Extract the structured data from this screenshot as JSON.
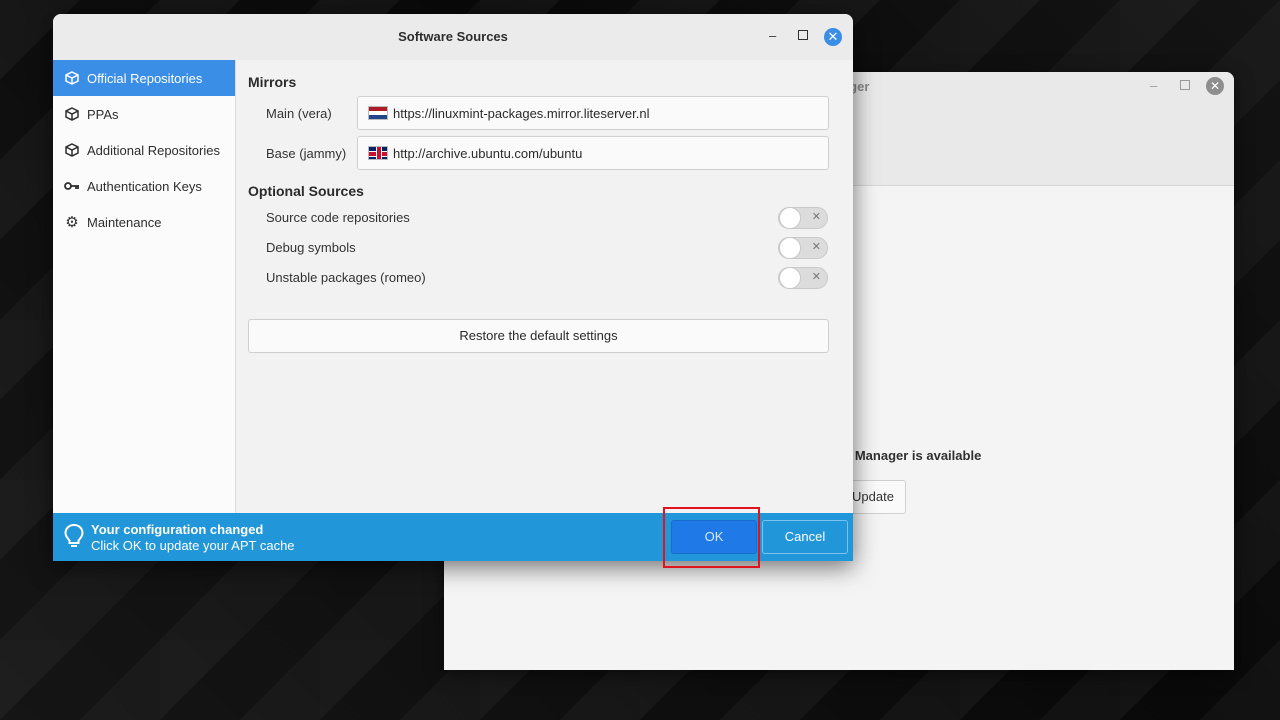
{
  "dialog": {
    "title": "Software Sources",
    "window_controls": {
      "minimize": "–",
      "close": "✕"
    }
  },
  "sidebar": {
    "items": [
      {
        "label": "Official Repositories",
        "icon": "box-icon",
        "active": true
      },
      {
        "label": "PPAs",
        "icon": "box-icon"
      },
      {
        "label": "Additional Repositories",
        "icon": "box-icon"
      },
      {
        "label": "Authentication Keys",
        "icon": "key-icon"
      },
      {
        "label": "Maintenance",
        "icon": "gear-icon"
      }
    ]
  },
  "mirrors": {
    "heading": "Mirrors",
    "main_label": "Main (vera)",
    "main_value": "https://linuxmint-packages.mirror.liteserver.nl",
    "main_flag": "netherlands-flag-icon",
    "base_label": "Base (jammy)",
    "base_value": "http://archive.ubuntu.com/ubuntu",
    "base_flag": "uk-flag-icon"
  },
  "optional": {
    "heading": "Optional Sources",
    "items": [
      {
        "label": "Source code repositories",
        "enabled": false
      },
      {
        "label": "Debug symbols",
        "enabled": false
      },
      {
        "label": "Unstable packages (romeo)",
        "enabled": false
      }
    ]
  },
  "restore_label": "Restore the default settings",
  "infobar": {
    "title": "Your configuration changed",
    "subtitle": "Click OK to update your APT cache",
    "ok_label": "OK",
    "cancel_label": "Cancel"
  },
  "background_window": {
    "title_fragment": "nager",
    "message_fragment": "e Manager is available",
    "button_fragment": "Update"
  },
  "colors": {
    "accent": "#3a8ee6",
    "infobar": "#2196d8",
    "highlight": "#e0141e"
  }
}
